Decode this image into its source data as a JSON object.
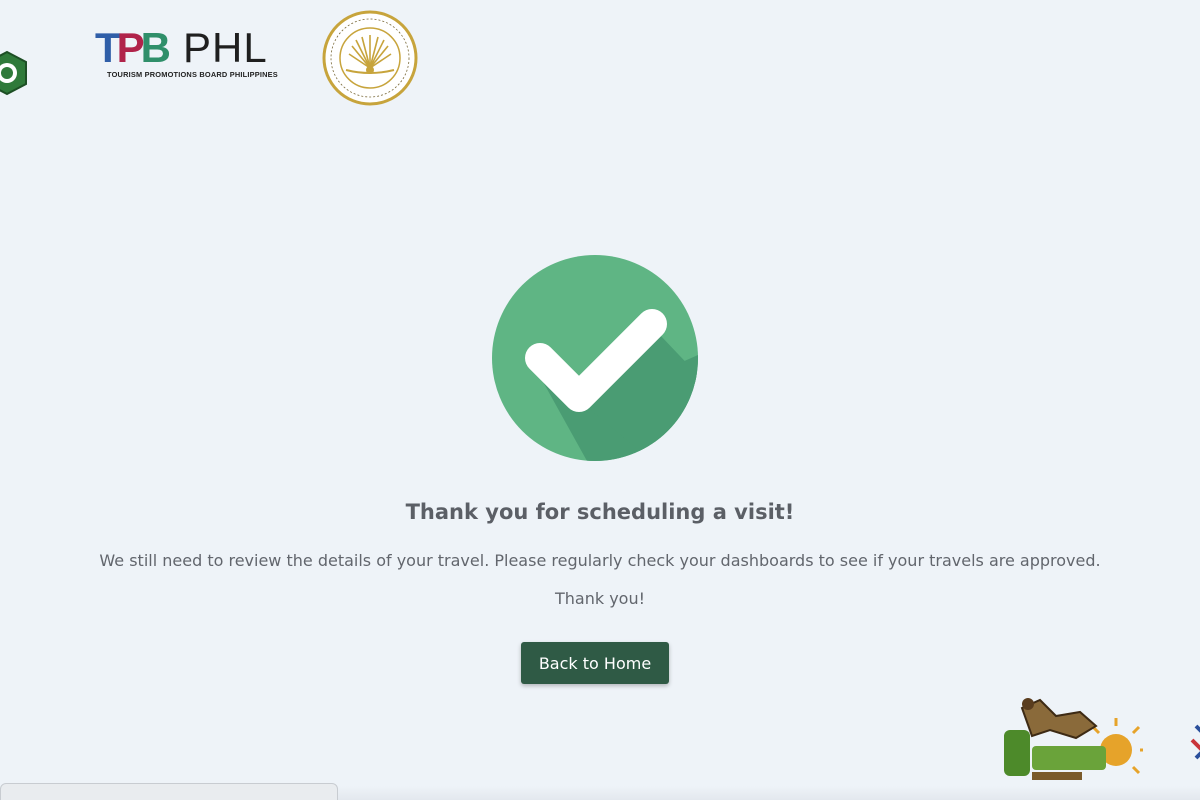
{
  "header": {
    "logos": [
      {
        "name": "partial-green-emblem"
      },
      {
        "name": "tpb-phl-logo",
        "mark": [
          "T",
          "P",
          "B"
        ],
        "wordmark": "PHL",
        "subtitle": "TOURISM PROMOTIONS BOARD PHILIPPINES"
      },
      {
        "name": "department-of-tourism-seal"
      }
    ]
  },
  "confirmation": {
    "icon": "check-circle-icon",
    "title": "Thank you for scheduling a visit!",
    "message": "We still need to review the details of your travel. Please regularly check your dashboards to see if your travels are approved.",
    "thanks": "Thank you!",
    "button_label": "Back to Home"
  },
  "colors": {
    "background": "#eef3f8",
    "check_green": "#5fb584",
    "check_shadow": "#4a9c73",
    "button": "#2f5a45",
    "text": "#62666d"
  }
}
